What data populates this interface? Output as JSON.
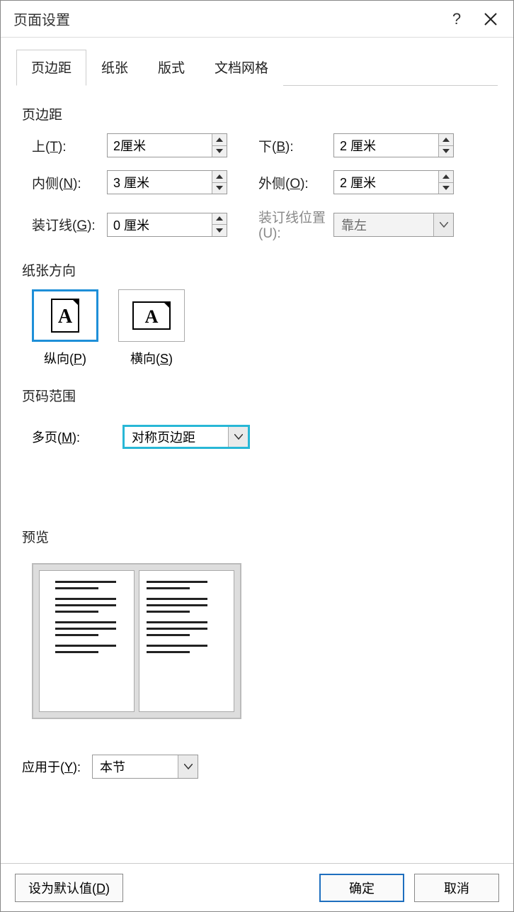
{
  "title": "页面设置",
  "tabs": [
    "页边距",
    "纸张",
    "版式",
    "文档网格"
  ],
  "margins": {
    "section": "页边距",
    "top_label": "上(T):",
    "top_value": "2厘米",
    "bottom_label": "下(B):",
    "bottom_value": "2 厘米",
    "inside_label": "内侧(N):",
    "inside_value": "3 厘米",
    "outside_label": "外侧(O):",
    "outside_value": "2 厘米",
    "gutter_label": "装订线(G):",
    "gutter_value": "0 厘米",
    "gutter_pos_label": "装订线位置(U):",
    "gutter_pos_value": "靠左"
  },
  "orientation": {
    "section": "纸张方向",
    "portrait": "纵向(P)",
    "landscape": "横向(S)"
  },
  "page_range": {
    "section": "页码范围",
    "multi_label": "多页(M):",
    "multi_value": "对称页边距"
  },
  "preview": {
    "section": "预览"
  },
  "apply_to": {
    "label": "应用于(Y):",
    "value": "本节"
  },
  "buttons": {
    "set_default": "设为默认值(D)",
    "ok": "确定",
    "cancel": "取消"
  }
}
